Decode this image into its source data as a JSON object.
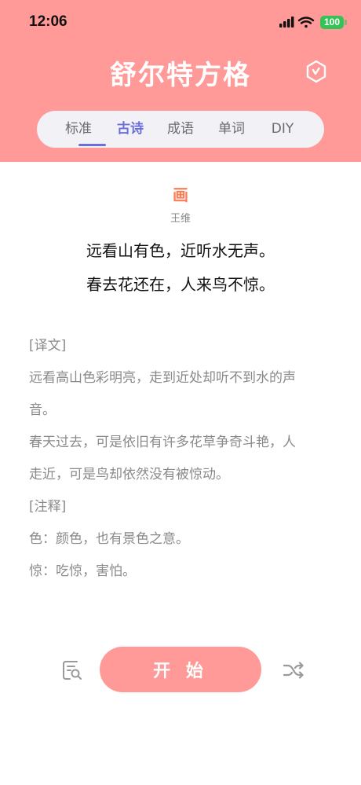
{
  "status_bar": {
    "time": "12:06",
    "battery": "100"
  },
  "header": {
    "title": "舒尔特方格"
  },
  "tabs": [
    {
      "label": "标准"
    },
    {
      "label": "古诗"
    },
    {
      "label": "成语"
    },
    {
      "label": "单词"
    },
    {
      "label": "DIY"
    }
  ],
  "active_tab": "古诗",
  "poem": {
    "title": "画",
    "author": "王维",
    "lines": [
      "远看山有色，近听水无声。",
      "春去花还在，人来鸟不惊。"
    ]
  },
  "notes": [
    "[译文]",
    "远看高山色彩明亮，走到近处却听不到水的声",
    "音。",
    "春天过去，可是依旧有许多花草争奇斗艳，人",
    "走近，可是鸟却依然没有被惊动。",
    "[注释]",
    "色：颜色，也有景色之意。",
    "惊：吃惊，害怕。"
  ],
  "actions": {
    "start_label": "开 始"
  },
  "colors": {
    "primary": "#ff9a98",
    "accent": "#6d6fd9",
    "poem_title": "#ff7b54"
  },
  "icons": {
    "signal": "cellular-signal-icon",
    "wifi": "wifi-icon",
    "hex": "hexagon-check-icon",
    "left": "document-search-icon",
    "right": "shuffle-icon"
  }
}
